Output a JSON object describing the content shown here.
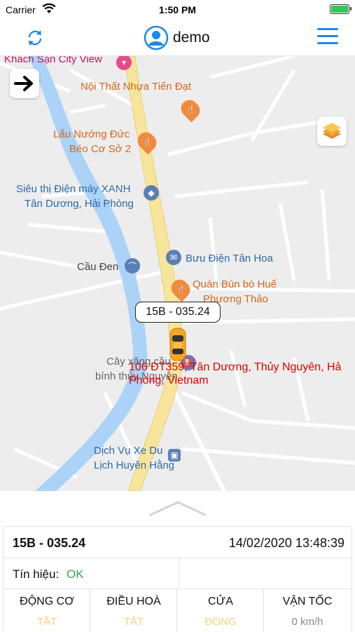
{
  "status_bar": {
    "carrier": "Carrier",
    "time": "1:50 PM"
  },
  "nav": {
    "title": "demo",
    "icons": [
      "refresh-icon",
      "user-avatar-icon",
      "menu-icon"
    ],
    "accent": "#1e88e5"
  },
  "map": {
    "pois": {
      "khach_san": "Khách Sạn City View",
      "noi_that": "Nội Thất Nhựa Tiến Đạt",
      "lau_nuong_1": "Lẩu Nướng Đức",
      "lau_nuong_2": "Béo Cơ Sở 2",
      "sieu_thi_1": "Siêu thị Điện máy XANH",
      "sieu_thi_2": "Tân Dương, Hải Phòng",
      "buu_dien": "Bưu Điện Tân Hoa",
      "cau_den": "Cầu Đen",
      "quan_bun_1": "Quán Bún bò Huế",
      "quan_bun_2": "Phương Thảo",
      "cay_xang_1": "Cây xăng cầu",
      "cay_xang_2": "bính thủy Nguyên",
      "dich_vu_1": "Dịch Vụ Xe Du",
      "dich_vu_2": "Lịch Huyền Hằng"
    },
    "address_line1": "106 ĐT359, Tân Dương, Thủy Nguyên, Hả",
    "address_line2": "Phòng, Vietnam",
    "plate_bubble": "15B - 035.24",
    "colors": {
      "river": "#aad3f7",
      "main_road": "#f7e59c",
      "poi_orange": "#d2691e",
      "poi_blue": "#2b6aa8",
      "address_red": "#e00000"
    }
  },
  "panel": {
    "plate": "15B - 035.24",
    "datetime": "14/02/2020 13:48:39",
    "signal_label": "Tín hiệu:",
    "signal_value": "OK",
    "cells": [
      {
        "label": "ĐỘNG CƠ",
        "value": "TẮT"
      },
      {
        "label": "ĐIỀU HOÀ",
        "value": "TẮT"
      },
      {
        "label": "CỬA",
        "value": "ĐÓNG"
      },
      {
        "label": "VẬN TỐC",
        "value": "0 km/h"
      }
    ]
  }
}
